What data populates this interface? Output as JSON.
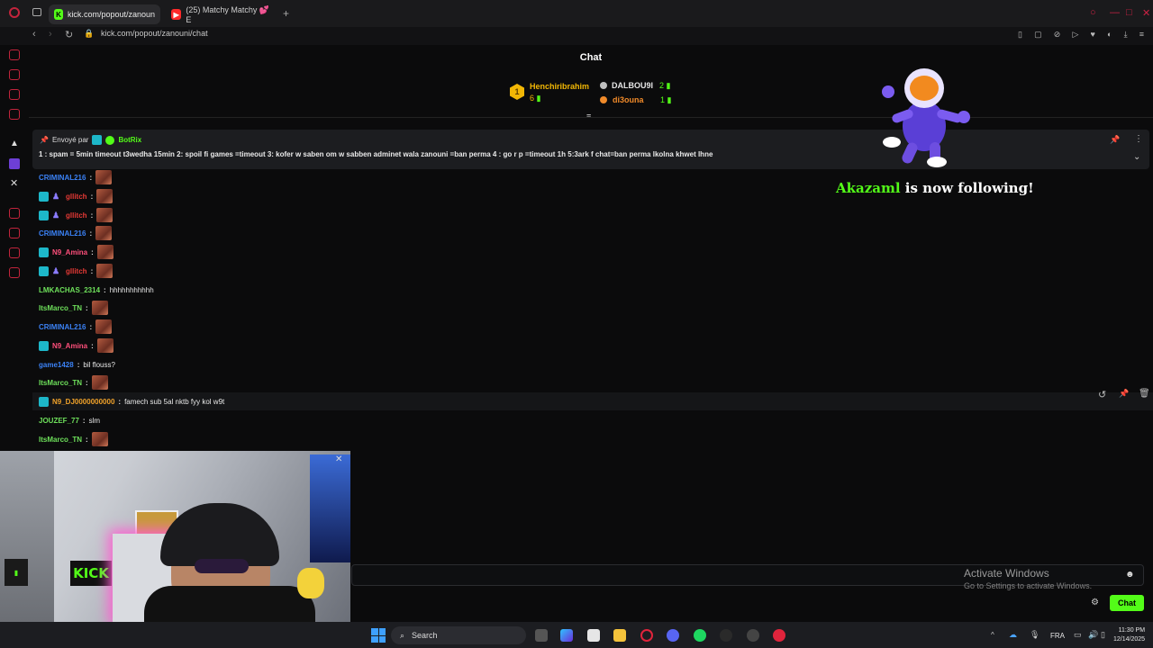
{
  "browser": {
    "tabs": [
      {
        "label": "kick.com/popout/zanoun",
        "active": true,
        "icon": "kick-icon",
        "icon_color": "#53fc18"
      },
      {
        "label": "(25) Matchy Matchy 💕 E",
        "active": false,
        "icon": "youtube-icon",
        "icon_color": "#ff2a2a"
      }
    ],
    "url": "kick.com/popout/zanouni/chat"
  },
  "chat": {
    "title": "Chat",
    "leaderboard": [
      {
        "rank": "1",
        "name": "Henchiribrahim",
        "count": "6",
        "color": "#f2b705"
      },
      {
        "rank": "",
        "name": "DALBOU9I",
        "count": "2",
        "color": "#e6e6e6"
      },
      {
        "rank": "",
        "name": "di3ouna",
        "count": "1",
        "color": "#f08a2a"
      }
    ],
    "pinned": {
      "sent_by_label": "Envoyé par",
      "sender": "BotRix",
      "text": "1 : spam = 5min timeout t3wedha 15min 2: spoil fi games =timeout 3: kofer w saben om w sabben adminet wala zanouni =ban perma 4 : go r p =timeout 1h 5:3ark f chat=ban perma lkolna khwet lhne"
    },
    "messages": [
      {
        "user": "CRIMINAL216",
        "color": "#3b82f6",
        "text": "",
        "emote": true
      },
      {
        "user": "gllitch",
        "color": "#e53935",
        "text": "",
        "emote": true
      },
      {
        "user": "gllitch",
        "color": "#e53935",
        "text": "",
        "emote": true
      },
      {
        "user": "CRIMINAL216",
        "color": "#3b82f6",
        "text": "",
        "emote": true
      },
      {
        "user": "N9_Amina",
        "color": "#ff4f7b",
        "text": "",
        "emote": true
      },
      {
        "user": "gllitch",
        "color": "#e53935",
        "text": "",
        "emote": true
      },
      {
        "user": "LMKACHAS_2314",
        "color": "#6ee05b",
        "text": "hhhhhhhhhhh",
        "emote": false
      },
      {
        "user": "ItsMarco_TN",
        "color": "#6ee05b",
        "text": "",
        "emote": true
      },
      {
        "user": "CRIMINAL216",
        "color": "#3b82f6",
        "text": "",
        "emote": true
      },
      {
        "user": "N9_Amina",
        "color": "#ff4f7b",
        "text": "",
        "emote": true
      },
      {
        "user": "game1428",
        "color": "#3b82f6",
        "text": "bil flouss?",
        "emote": false
      },
      {
        "user": "ItsMarco_TN",
        "color": "#6ee05b",
        "text": "",
        "emote": true
      },
      {
        "user": "N9_DJ0000000000",
        "color": "#f0a22a",
        "text": "famech sub 5al nktb fyy kol w9t",
        "emote": false
      },
      {
        "user": "JOUZEF_77",
        "color": "#6ee05b",
        "text": "slm",
        "emote": false
      },
      {
        "user": "ItsMarco_TN",
        "color": "#6ee05b",
        "text": "",
        "emote": true
      }
    ],
    "follow_alert": {
      "name": "Akazaml",
      "text": "is now following!"
    },
    "send_button": "Chat"
  },
  "watermark": {
    "title": "Activate Windows",
    "subtitle": "Go to Settings to activate Windows."
  },
  "taskbar": {
    "search_placeholder": "Search",
    "language": "FRA",
    "time": "11:30 PM",
    "date": "12/14/2025"
  },
  "webcam": {
    "sign": "KICK"
  }
}
